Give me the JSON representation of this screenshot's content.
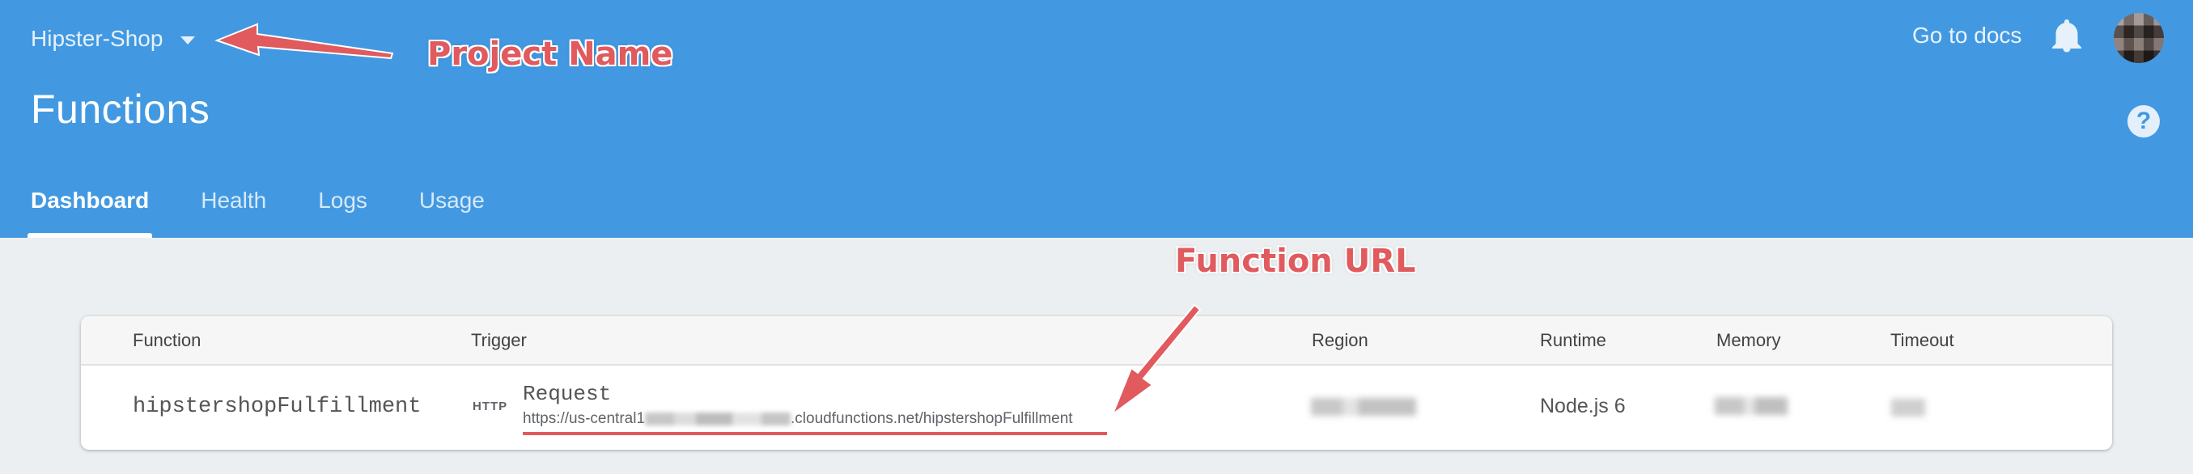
{
  "header": {
    "project_name": "Hipster-Shop",
    "page_title": "Functions",
    "docs_link": "Go to docs",
    "help_symbol": "?",
    "tabs": [
      "Dashboard",
      "Health",
      "Logs",
      "Usage"
    ],
    "active_tab": "Dashboard",
    "accent_color": "#4299e1",
    "icons": [
      "chevron-down-icon",
      "bell-icon",
      "avatar",
      "help-icon"
    ]
  },
  "table": {
    "columns": [
      "Function",
      "Trigger",
      "Region",
      "Runtime",
      "Memory",
      "Timeout"
    ],
    "rows": [
      {
        "function": "hipstershopFulfillment",
        "trigger_badge": "HTTP",
        "trigger_type": "Request",
        "trigger_url_prefix": "https://us-central1",
        "trigger_url_suffix": ".cloudfunctions.net/hipstershopFulfillment",
        "region": "",
        "runtime": "Node.js 6",
        "memory": "",
        "timeout": ""
      }
    ]
  },
  "annotations": {
    "project_name": "Project Name",
    "function_url": "Function URL",
    "color": "#e05a5e"
  }
}
